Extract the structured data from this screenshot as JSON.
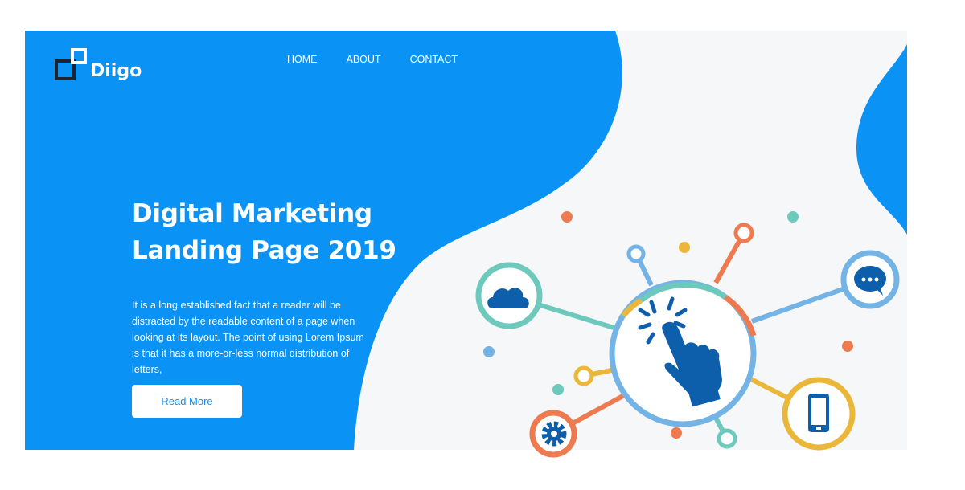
{
  "brand": {
    "name": "Diigo"
  },
  "nav": {
    "items": [
      {
        "label": "HOME"
      },
      {
        "label": "ABOUT"
      },
      {
        "label": "CONTACT"
      }
    ]
  },
  "hero": {
    "title_line1": "Digital Marketing",
    "title_line2": "Landing Page 2019",
    "paragraph": "It is a long established fact that a reader will be distracted by the readable content of a page when looking at its layout. The point of using Lorem Ipsum is that it has a more-or-less normal distribution of letters,",
    "button_label": "Read More"
  },
  "colors": {
    "brand_blue": "#0b92f5",
    "teal": "#6ec9bd",
    "orange": "#ee7b4f",
    "yellow": "#eab73a",
    "light_blue": "#74b3e6",
    "icon_blue": "#0d5eab"
  },
  "illustration": {
    "icons": [
      "cloud-icon",
      "chat-bubble-icon",
      "smartphone-icon",
      "gear-icon",
      "click-hand-icon"
    ]
  }
}
